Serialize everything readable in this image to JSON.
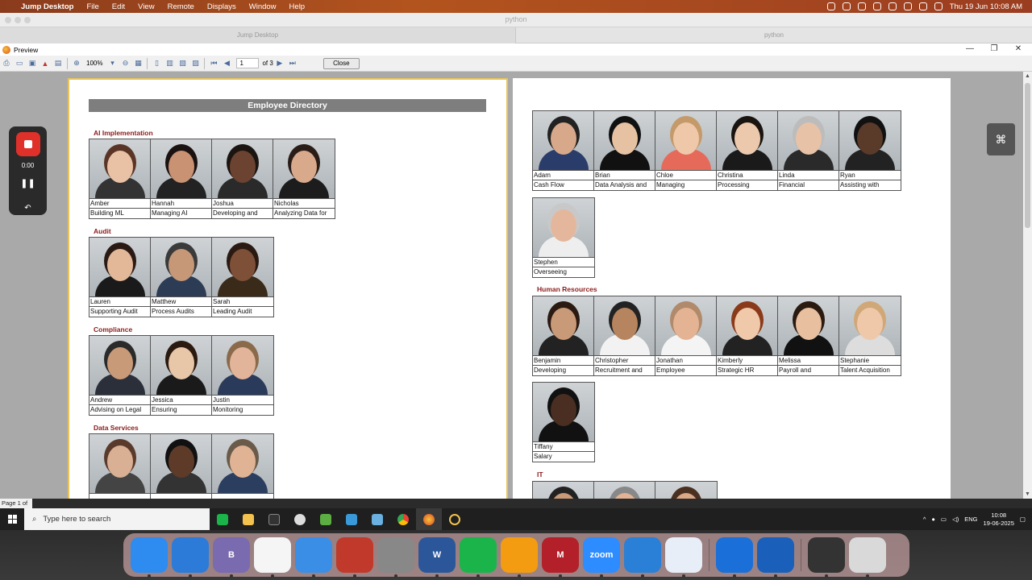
{
  "menubar": {
    "app": "Jump Desktop",
    "items": [
      "File",
      "Edit",
      "View",
      "Remote",
      "Displays",
      "Window",
      "Help"
    ],
    "clock": "Thu 19 Jun  10:08 AM"
  },
  "window": {
    "title": "python",
    "tabs": [
      "Jump Desktop",
      "python"
    ]
  },
  "preview": {
    "title": "Preview",
    "zoom": "100%",
    "page_value": "1",
    "page_of": "of 3",
    "close_label": "Close",
    "status": "Page 1 of"
  },
  "recorder": {
    "time": "0:00"
  },
  "directory": {
    "title": "Employee Directory",
    "page1": [
      {
        "dept": "AI Implementation",
        "people": [
          {
            "name": "Amber",
            "role": "Building ML",
            "skin": "#e9c2a6",
            "hair": "#5a3526",
            "shirt": "#333"
          },
          {
            "name": "Hannah",
            "role": "Managing AI",
            "skin": "#c99272",
            "hair": "#1a1210",
            "shirt": "#222"
          },
          {
            "name": "Joshua",
            "role": "Developing and",
            "skin": "#6b4330",
            "hair": "#1b1410",
            "shirt": "#2a2a2a"
          },
          {
            "name": "Nicholas",
            "role": "Analyzing Data for",
            "skin": "#d9a98c",
            "hair": "#2a1d18",
            "shirt": "#1c1c1c"
          }
        ]
      },
      {
        "dept": "Audit",
        "people": [
          {
            "name": "Lauren",
            "role": "Supporting Audit",
            "skin": "#e2b899",
            "hair": "#2b1a14",
            "shirt": "#1a1a1a"
          },
          {
            "name": "Matthew",
            "role": "Process Audits",
            "skin": "#c69878",
            "hair": "#3a3a3a",
            "shirt": "#2d3c55"
          },
          {
            "name": "Sarah",
            "role": "Leading Audit",
            "skin": "#7e5038",
            "hair": "#2a1a12",
            "shirt": "#3a2a1a"
          }
        ]
      },
      {
        "dept": "Compliance",
        "people": [
          {
            "name": "Andrew",
            "role": "Advising on Legal",
            "skin": "#c99a78",
            "hair": "#2a2a2a",
            "shirt": "#2b2f3a"
          },
          {
            "name": "Jessica",
            "role": "Ensuring",
            "skin": "#e8c6a8",
            "hair": "#2a1a10",
            "shirt": "#1a1a1a"
          },
          {
            "name": "Justin",
            "role": "Monitoring",
            "skin": "#e2b59a",
            "hair": "#8a6a4a",
            "shirt": "#2a3a5a"
          }
        ]
      },
      {
        "dept": "Data Services",
        "people": [
          {
            "name": "",
            "role": "",
            "skin": "#d9b094",
            "hair": "#5a3a2a",
            "shirt": "#444"
          },
          {
            "name": "",
            "role": "",
            "skin": "#5e3b29",
            "hair": "#111",
            "shirt": "#333"
          },
          {
            "name": "",
            "role": "",
            "skin": "#e0b394",
            "hair": "#6a5a4a",
            "shirt": "#2c3e60"
          }
        ]
      }
    ],
    "page2_top": [
      {
        "name": "Adam",
        "role": "Cash Flow",
        "skin": "#d8a88a",
        "hair": "#222",
        "shirt": "#2a3c6a"
      },
      {
        "name": "Brian",
        "role": "Data Analysis and",
        "skin": "#e6c2a2",
        "hair": "#111",
        "shirt": "#111"
      },
      {
        "name": "Chloe",
        "role": "Managing",
        "skin": "#efc8aa",
        "hair": "#c49a6a",
        "shirt": "#e66a5a"
      },
      {
        "name": "Christina",
        "role": "Processing",
        "skin": "#ecc9ac",
        "hair": "#1a1410",
        "shirt": "#1a1a1a"
      },
      {
        "name": "Linda",
        "role": "Financial",
        "skin": "#e8c2a6",
        "hair": "#bcbcbc",
        "shirt": "#2a2a2a"
      },
      {
        "name": "Ryan",
        "role": "Assisting with",
        "skin": "#5a3a28",
        "hair": "#111",
        "shirt": "#222"
      }
    ],
    "page2_top2": [
      {
        "name": "Stephen",
        "role": "Overseeing",
        "skin": "#e4b79c",
        "hair": "#c8c8c8",
        "shirt": "#eee"
      }
    ],
    "page2_hr": {
      "dept": "Human Resources",
      "people": [
        {
          "name": "Benjamin",
          "role": "Developing",
          "skin": "#c99a78",
          "hair": "#2a1a12",
          "shirt": "#222"
        },
        {
          "name": "Christopher",
          "role": "Recruitment and",
          "skin": "#b6845e",
          "hair": "#222",
          "shirt": "#f2f2f2"
        },
        {
          "name": "Jonathan",
          "role": "Employee",
          "skin": "#e3b394",
          "hair": "#b08a6a",
          "shirt": "#f4f4f4"
        },
        {
          "name": "Kimberly",
          "role": "Strategic HR",
          "skin": "#f0c8aa",
          "hair": "#8a3a1a",
          "shirt": "#222"
        },
        {
          "name": "Melissa",
          "role": "Payroll and",
          "skin": "#e8bf9f",
          "hair": "#2a1a10",
          "shirt": "#111"
        },
        {
          "name": "Stephanie",
          "role": "Talent Acquisition",
          "skin": "#efc8aa",
          "hair": "#d0a878",
          "shirt": "#ddd"
        }
      ]
    },
    "page2_hr2": [
      {
        "name": "Tiffany",
        "role": "Salary",
        "skin": "#4a2e22",
        "hair": "#111",
        "shirt": "#111"
      }
    ],
    "page2_it": {
      "dept": "IT",
      "people": [
        {
          "name": "",
          "role": "",
          "skin": "#c99a78",
          "hair": "#222",
          "shirt": "#333"
        },
        {
          "name": "",
          "role": "",
          "skin": "#e2b394",
          "hair": "#888",
          "shirt": "#333"
        },
        {
          "name": "",
          "role": "",
          "skin": "#d9a886",
          "hair": "#4a3020",
          "shirt": "#333"
        }
      ]
    }
  },
  "taskbar": {
    "search_placeholder": "Type here to search",
    "lang": "ENG",
    "time": "10:08",
    "date": "19-06-2025"
  },
  "dock": {
    "apps": [
      {
        "name": "Finder",
        "color": "#2e8bf0",
        "label": ""
      },
      {
        "name": "Safari",
        "color": "#2c7bd9",
        "label": ""
      },
      {
        "name": "BBEdit",
        "color": "#7a6ab0",
        "label": "B"
      },
      {
        "name": "Broom",
        "color": "#f5f5f5",
        "label": ""
      },
      {
        "name": "Bookmarks",
        "color": "#3a8ee6",
        "label": ""
      },
      {
        "name": "Paprika",
        "color": "#c0392b",
        "label": ""
      },
      {
        "name": "Settings",
        "color": "#888",
        "label": ""
      },
      {
        "name": "Word",
        "color": "#2b579a",
        "label": "W"
      },
      {
        "name": "Jump",
        "color": "#1bb44a",
        "label": ""
      },
      {
        "name": "Books",
        "color": "#f39c12",
        "label": ""
      },
      {
        "name": "Mendeley",
        "color": "#b3202a",
        "label": "M"
      },
      {
        "name": "Zoom",
        "color": "#2d8cff",
        "label": "zoom"
      },
      {
        "name": "Keynote",
        "color": "#2a7fd6",
        "label": ""
      },
      {
        "name": "Transmit",
        "color": "#e8eef8",
        "label": ""
      },
      {
        "name": "1Password",
        "color": "#1a6fd9",
        "label": ""
      },
      {
        "name": "1Password2",
        "color": "#1a5fb9",
        "label": ""
      },
      {
        "name": "Printer",
        "color": "#333",
        "label": ""
      },
      {
        "name": "Trash",
        "color": "#d9d9d9",
        "label": ""
      }
    ]
  }
}
